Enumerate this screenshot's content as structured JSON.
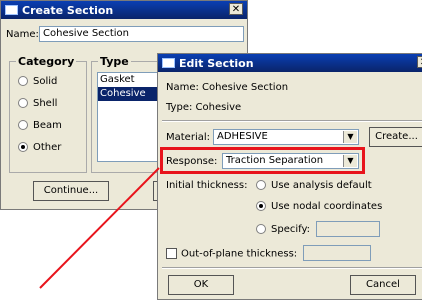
{
  "create_section": {
    "title": "Create Section",
    "name_label": "Name:",
    "name_value": "Cohesive Section",
    "category_label": "Category",
    "type_label": "Type",
    "categories": [
      "Solid",
      "Shell",
      "Beam",
      "Other"
    ],
    "selected_category": "Other",
    "types": [
      "Gasket",
      "Cohesive"
    ],
    "selected_type": "Cohesive",
    "continue_label": "Continue..."
  },
  "edit_section": {
    "title": "Edit Section",
    "name_line": "Name:  Cohesive Section",
    "type_line": "Type:  Cohesive",
    "material_label": "Material:",
    "material_value": "ADHESIVE",
    "create_label": "Create...",
    "response_label": "Response:",
    "response_value": "Traction Separation",
    "thickness_label": "Initial thickness:",
    "thickness_options": [
      "Use analysis default",
      "Use nodal coordinates",
      "Specify:"
    ],
    "selected_thickness": "Use nodal coordinates",
    "out_of_plane_label": "Out-of-plane thickness:",
    "ok_label": "OK",
    "cancel_label": "Cancel"
  },
  "annotation_color": "#e8141c"
}
